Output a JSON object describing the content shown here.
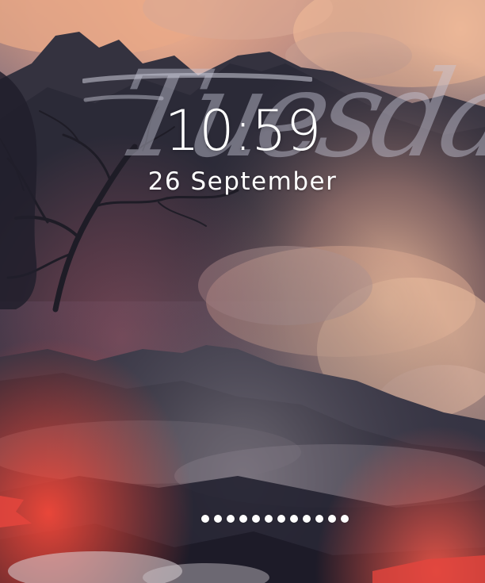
{
  "lock_screen": {
    "weekday": "Tuesday",
    "time": "10:59",
    "date": "26 September",
    "passcode_dot_count": 12
  },
  "colors": {
    "sky_top": "#f2a77c",
    "mountain_dark": "#2b2a3a",
    "cloud_glow": "#f2b48d",
    "lava": "#e0454a",
    "text": "#ffffff",
    "script_text": "#c8c8d6"
  }
}
